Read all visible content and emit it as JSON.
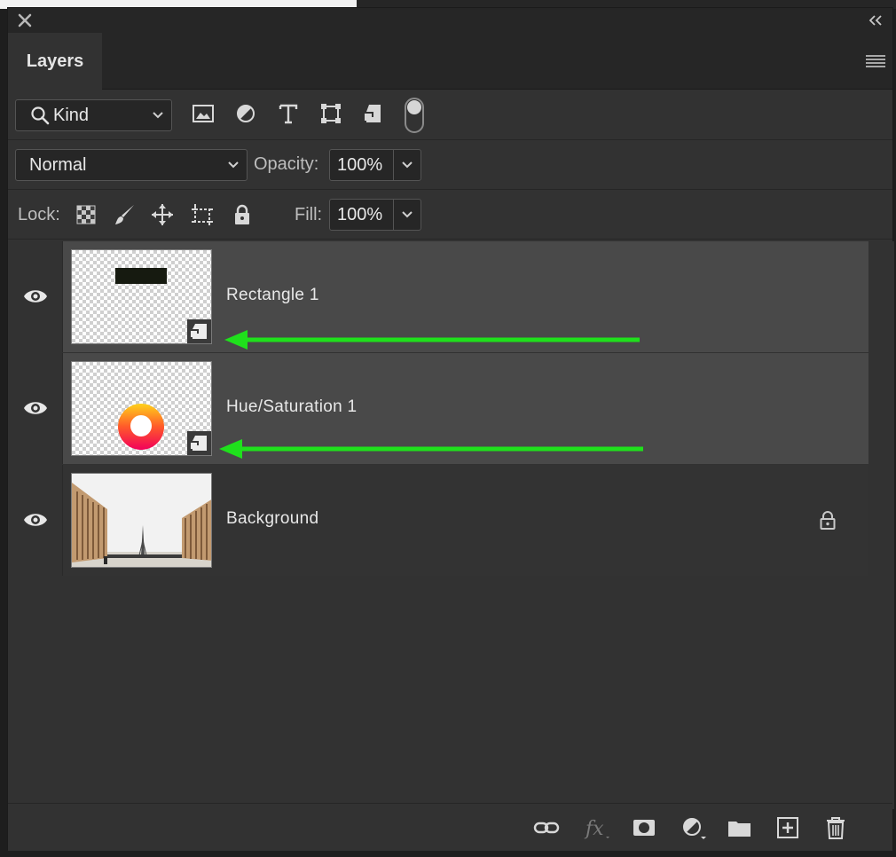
{
  "panel": {
    "tab_label": "Layers"
  },
  "filter": {
    "kind_label": "Kind",
    "icons": [
      "pixel-layer-filter-icon",
      "adjustment-layer-filter-icon",
      "type-layer-filter-icon",
      "shape-layer-filter-icon",
      "smart-object-filter-icon"
    ]
  },
  "blend": {
    "mode": "Normal",
    "opacity_label": "Opacity:",
    "opacity_value": "100%"
  },
  "lock": {
    "label": "Lock:",
    "fill_label": "Fill:",
    "fill_value": "100%"
  },
  "layers": [
    {
      "name": "Rectangle 1",
      "selected": true,
      "type": "smart-object",
      "annotation_color": "#1fe01c"
    },
    {
      "name": "Hue/Saturation 1",
      "selected": true,
      "type": "smart-object",
      "annotation_color": "#1fe01c"
    },
    {
      "name": "Background",
      "selected": false,
      "type": "image",
      "locked": true
    }
  ],
  "footer": {
    "icons": [
      "link-layers-icon",
      "fx-icon",
      "layer-mask-icon",
      "new-adjustment-icon",
      "new-group-icon",
      "new-layer-icon",
      "delete-icon"
    ]
  },
  "colors": {
    "panel_bg": "#323232",
    "selected_row": "#494949",
    "arrow": "#1fe01c"
  }
}
